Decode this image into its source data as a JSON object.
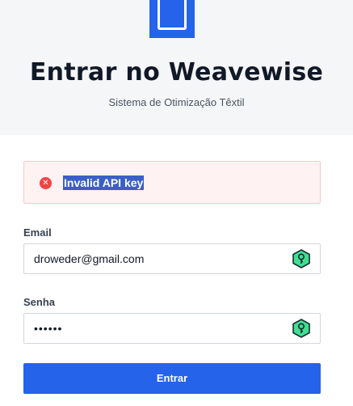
{
  "brand": {
    "title": "Entrar no Weavewise",
    "subtitle": "Sistema de Otimização Têxtil",
    "logo_icon": "app-logo-icon",
    "accent": "#2563eb"
  },
  "alert": {
    "message": "Invalid API key",
    "icon": "error-circle-icon",
    "color": "#ef4444"
  },
  "form": {
    "email_label": "Email",
    "email_value": "droweder@gmail.com",
    "password_label": "Senha",
    "password_value": "••••••",
    "password_manager_icon": "password-manager-key-icon",
    "submit_label": "Entrar"
  }
}
